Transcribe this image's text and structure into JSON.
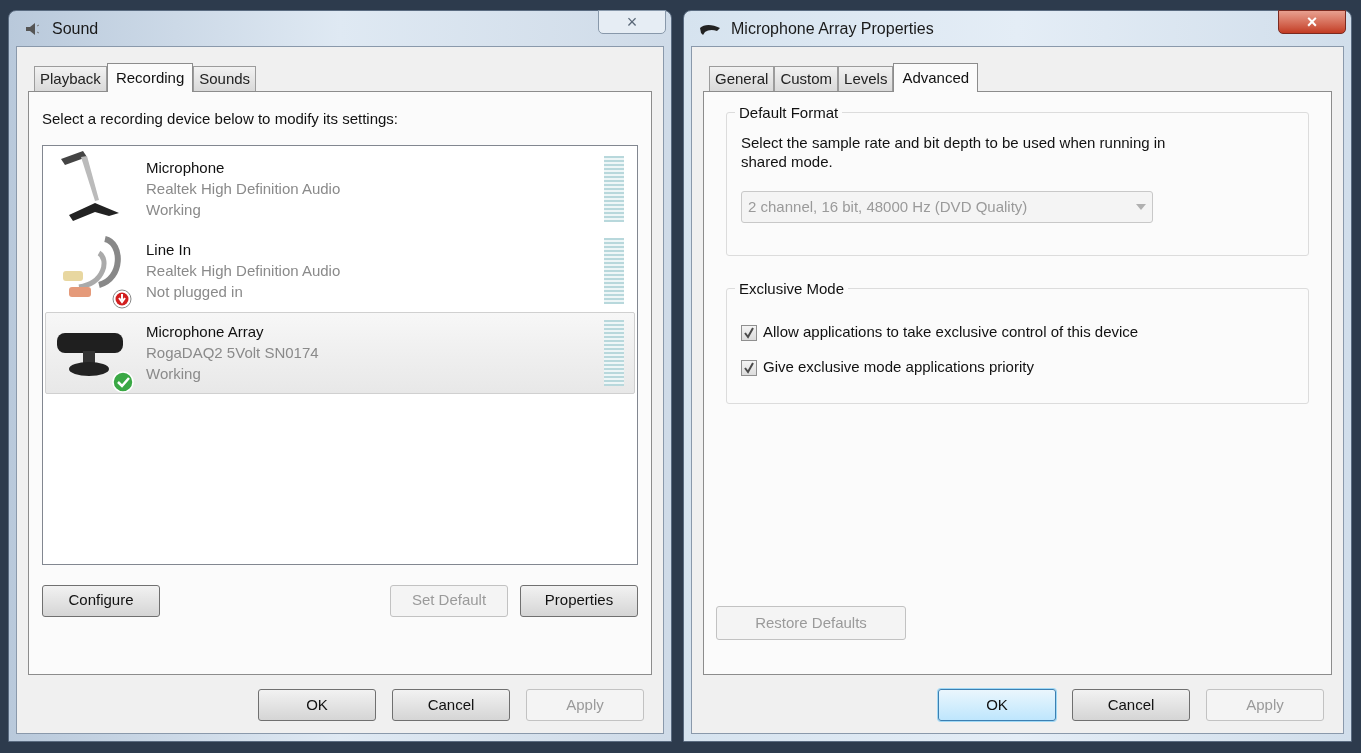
{
  "sound_window": {
    "title": "Sound",
    "close": "×",
    "tabs": [
      {
        "label": "Playback",
        "selected": false
      },
      {
        "label": "Recording",
        "selected": true
      },
      {
        "label": "Sounds",
        "selected": false
      }
    ],
    "instruction": "Select a recording device below to modify its settings:",
    "devices": [
      {
        "kind": "microphone",
        "name": "Microphone",
        "driver": "Realtek High Definition Audio",
        "status": "Working",
        "unplugged": false,
        "is_default": false,
        "selected": false
      },
      {
        "kind": "line_in",
        "name": "Line In",
        "driver": "Realtek High Definition Audio",
        "status": "Not plugged in",
        "unplugged": true,
        "is_default": false,
        "selected": false
      },
      {
        "kind": "mic_array",
        "name": "Microphone Array",
        "driver": "RogaDAQ2 5Volt SN0174",
        "status": "Working",
        "unplugged": false,
        "is_default": true,
        "selected": true
      }
    ],
    "panel_buttons": [
      {
        "label": "Configure",
        "disabled": false
      },
      {
        "label": "Set Default",
        "disabled": true
      },
      {
        "label": "Properties",
        "disabled": false
      }
    ],
    "dialog_buttons": [
      {
        "label": "OK",
        "disabled": false,
        "focused": false
      },
      {
        "label": "Cancel",
        "disabled": false,
        "focused": false
      },
      {
        "label": "Apply",
        "disabled": true,
        "focused": false
      }
    ]
  },
  "properties_window": {
    "title": "Microphone Array Properties",
    "close": "×",
    "tabs": [
      {
        "label": "General",
        "selected": false
      },
      {
        "label": "Custom",
        "selected": false
      },
      {
        "label": "Levels",
        "selected": false
      },
      {
        "label": "Advanced",
        "selected": true
      }
    ],
    "default_format": {
      "heading": "Default Format",
      "description": "Select the sample rate and bit depth to be used when running in shared mode.",
      "format": {
        "value": "2 channel, 16 bit, 48000 Hz (DVD Quality)",
        "disabled": true
      }
    },
    "exclusive_mode": {
      "heading": "Exclusive Mode",
      "options": [
        {
          "label": "Allow applications to take exclusive control of this device",
          "checked": true
        },
        {
          "label": "Give exclusive mode applications priority",
          "checked": true
        }
      ]
    },
    "restore_button": {
      "label": "Restore Defaults",
      "disabled": true
    },
    "dialog_buttons": [
      {
        "label": "OK",
        "disabled": false,
        "focused": true
      },
      {
        "label": "Cancel",
        "disabled": false,
        "focused": false
      },
      {
        "label": "Apply",
        "disabled": true,
        "focused": false
      }
    ]
  }
}
